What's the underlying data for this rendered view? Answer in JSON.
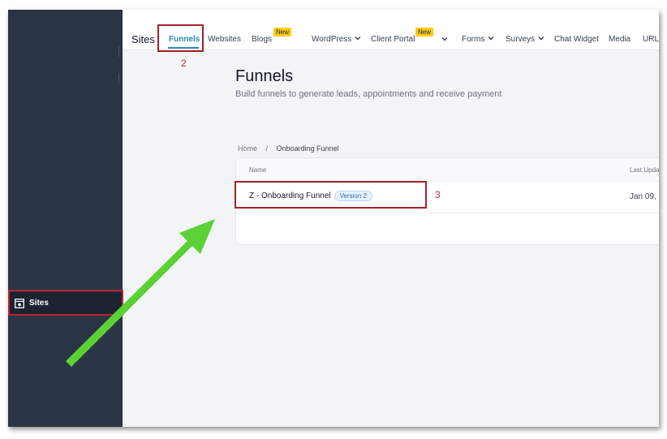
{
  "sidebar": {
    "item_label": "Sites",
    "item_icon": "sites-icon"
  },
  "topbar": {
    "brand": "Sites",
    "nav": {
      "funnels": "Funnels",
      "websites": "Websites",
      "blogs": "Blogs",
      "wordpress": "WordPress",
      "client_portal": "Client Portal",
      "forms": "Forms",
      "surveys": "Surveys",
      "chat_widget": "Chat Widget",
      "media": "Media",
      "url": "URL"
    },
    "new_badge": "New"
  },
  "annotations": {
    "step2": "2",
    "step3": "3"
  },
  "page": {
    "title": "Funnels",
    "subtitle": "Build funnels to generate leads, appointments and receive payment"
  },
  "breadcrumb": {
    "home": "Home",
    "separator": "/",
    "current": "Onboarding Funnel"
  },
  "table": {
    "columns": {
      "name": "Name",
      "last_updated": "Last Upda"
    },
    "rows": [
      {
        "name": "Z - Onboarding Funnel",
        "version": "Version 2",
        "date": "Jan 09,"
      }
    ]
  },
  "colors": {
    "sidebar": "#2b3445",
    "accent": "#2a8ab5",
    "annotation": "#b3262f",
    "arrow": "#5bd136",
    "new_badge": "#facc15"
  }
}
